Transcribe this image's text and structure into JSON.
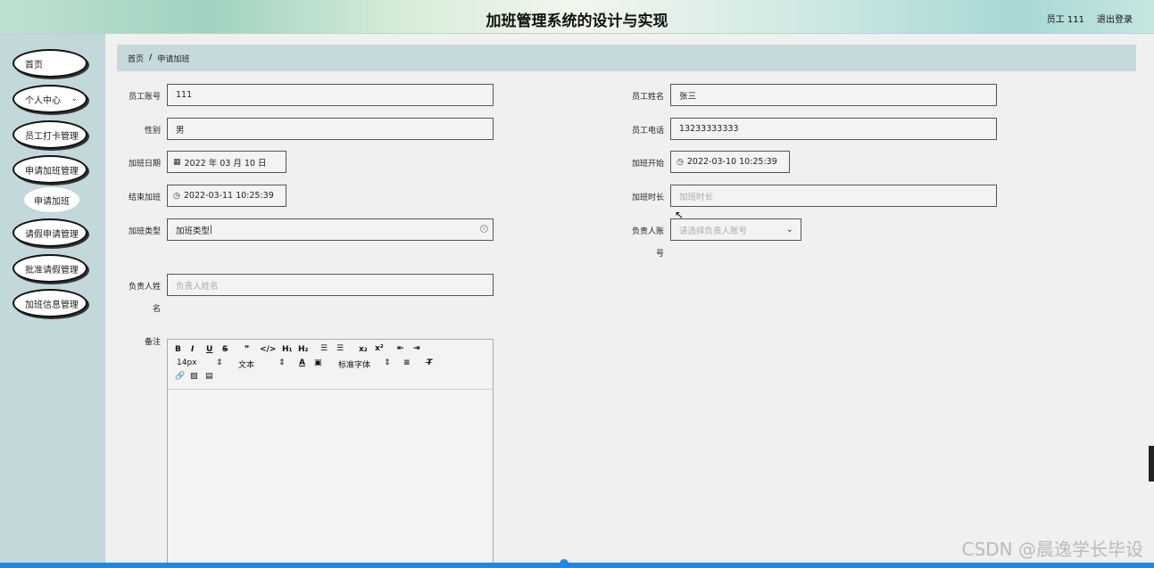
{
  "header": {
    "title": "加班管理系统的设计与实现",
    "user": "员工 111",
    "logout": "退出登录"
  },
  "sidebar": {
    "items": [
      {
        "label": "首页"
      },
      {
        "label": "个人中心"
      },
      {
        "label": "员工打卡管理"
      },
      {
        "label": "申请加班管理"
      },
      {
        "label": "申请加班"
      },
      {
        "label": "请假申请管理"
      },
      {
        "label": "批准请假管理"
      },
      {
        "label": "加班信息管理"
      }
    ]
  },
  "breadcrumb": {
    "home": "首页",
    "separator": "/",
    "current": "申请加班"
  },
  "form": {
    "account_label": "员工账号",
    "account_value": "111",
    "name_label": "员工姓名",
    "name_value": "张三",
    "gender_label": "性别",
    "gender_value": "男",
    "phone_label": "员工电话",
    "phone_value": "13233333333",
    "date_label": "加班日期",
    "date_value": "2022 年 03 月 10 日",
    "start_label": "加班开始",
    "start_value": "2022-03-10 10:25:39",
    "end_label": "结束加班",
    "end_value": "2022-03-11 10:25:39",
    "duration_label": "加班时长",
    "duration_placeholder": "加班时长",
    "type_label": "加班类型",
    "type_value": "加班类型",
    "manager_account_label_1": "负责人账",
    "manager_account_label_2": "号",
    "manager_account_placeholder": "请选择负责人账号",
    "manager_name_label_1": "负责人姓",
    "manager_name_label_2": "名",
    "manager_name_placeholder": "负责人姓名",
    "remark_label": "备注"
  },
  "editor": {
    "font_size": "14px",
    "block_type": "文本",
    "font_family": "标准字体"
  },
  "watermark": "CSDN @晨逸学长毕设"
}
